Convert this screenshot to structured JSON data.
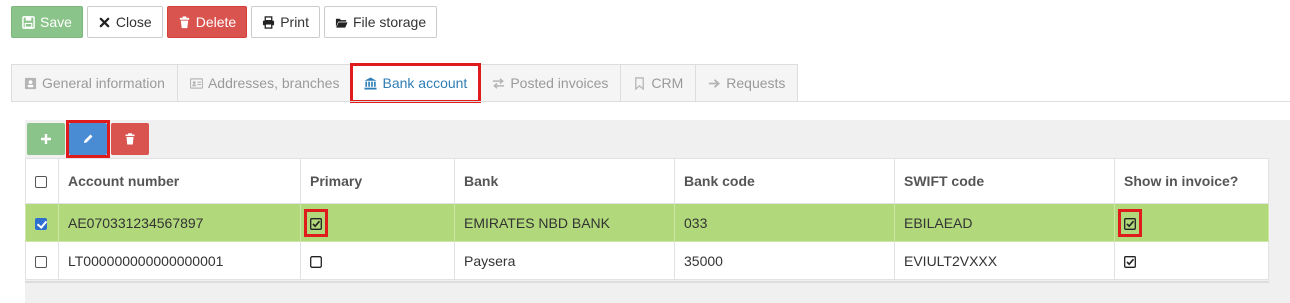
{
  "toolbar": {
    "save_label": "Save",
    "close_label": "Close",
    "delete_label": "Delete",
    "print_label": "Print",
    "file_storage_label": "File storage"
  },
  "tabs": [
    {
      "label": "General information",
      "icon": "id-card-icon",
      "active": false
    },
    {
      "label": "Addresses, branches",
      "icon": "address-card-icon",
      "active": false
    },
    {
      "label": "Bank account",
      "icon": "bank-icon",
      "active": true
    },
    {
      "label": "Posted invoices",
      "icon": "exchange-icon",
      "active": false
    },
    {
      "label": "CRM",
      "icon": "bookmark-icon",
      "active": false
    },
    {
      "label": "Requests",
      "icon": "arrow-right-icon",
      "active": false
    }
  ],
  "table": {
    "headers": [
      "Account number",
      "Primary",
      "Bank",
      "Bank code",
      "SWIFT code",
      "Show in invoice?"
    ],
    "rows": [
      {
        "selected": true,
        "account_number": "AE070331234567897",
        "primary": true,
        "bank": "EMIRATES NBD BANK",
        "bank_code": "033",
        "swift": "EBILAEAD",
        "show_in_invoice": true
      },
      {
        "selected": false,
        "account_number": "LT000000000000000001",
        "primary": false,
        "bank": "Paysera",
        "bank_code": "35000",
        "swift": "EVIULT2VXXX",
        "show_in_invoice": true
      }
    ]
  },
  "colors": {
    "save": "#8bc48a",
    "delete": "#d9534f",
    "selected_row": "#b1d97b",
    "active_tab_text": "#2f7eb6",
    "highlight": "#e01b1b"
  }
}
